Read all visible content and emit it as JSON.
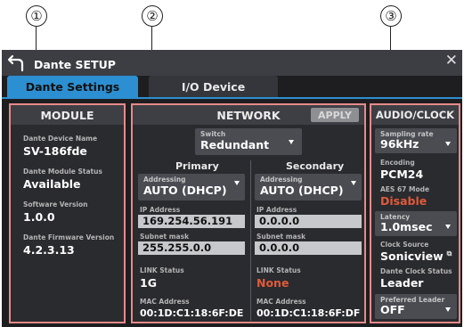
{
  "callouts": [
    "①",
    "②",
    "③"
  ],
  "titlebar": {
    "title": "Dante SETUP"
  },
  "tabs": [
    {
      "label": "Dante Settings",
      "active": true
    },
    {
      "label": "I/O Device",
      "active": false
    }
  ],
  "module": {
    "header": "MODULE",
    "device_name_label": "Dante Device Name",
    "device_name": "SV-186fde",
    "status_label": "Dante Module Status",
    "status": "Available",
    "sw_label": "Software Version",
    "sw": "1.0.0",
    "fw_label": "Dante Firmware Version",
    "fw": "4.2.3.13"
  },
  "network": {
    "header": "NETWORK",
    "apply": "APPLY",
    "switch_label": "Switch",
    "switch_value": "Redundant",
    "primary": {
      "title": "Primary",
      "addressing_label": "Addressing",
      "addressing": "AUTO (DHCP)",
      "ip_label": "IP Address",
      "ip": "169.254.56.191",
      "subnet_label": "Subnet mask",
      "subnet": "255.255.0.0",
      "link_label": "LINK Status",
      "link": "1G",
      "mac_label": "MAC Address",
      "mac": "00:1D:C1:18:6F:DE"
    },
    "secondary": {
      "title": "Secondary",
      "addressing_label": "Addressing",
      "addressing": "AUTO (DHCP)",
      "ip_label": "IP Address",
      "ip": "0.0.0.0",
      "subnet_label": "Subnet mask",
      "subnet": "0.0.0.0",
      "link_label": "LINK Status",
      "link": "None",
      "mac_label": "MAC Address",
      "mac": "00:1D:C1:18:6F:DF"
    }
  },
  "audio": {
    "header": "AUDIO/CLOCK",
    "sampling_label": "Sampling rate",
    "sampling": "96kHz",
    "encoding_label": "Encoding",
    "encoding": "PCM24",
    "aes67_label": "AES 67 Mode",
    "aes67": "Disable",
    "latency_label": "Latency",
    "latency": "1.0msec",
    "clock_source_label": "Clock Source",
    "clock_source": "Sonicview",
    "clock_status_label": "Dante Clock Status",
    "clock_status": "Leader",
    "preferred_label": "Preferred Leader",
    "preferred": "OFF"
  },
  "colors": {
    "accent": "#2c8fd1",
    "panel_border": "#e78a8a",
    "warning": "#e05a3a"
  },
  "icons": [
    "back-arrow-icon",
    "close-icon",
    "dropdown-arrow-icon",
    "external-link-icon"
  ]
}
